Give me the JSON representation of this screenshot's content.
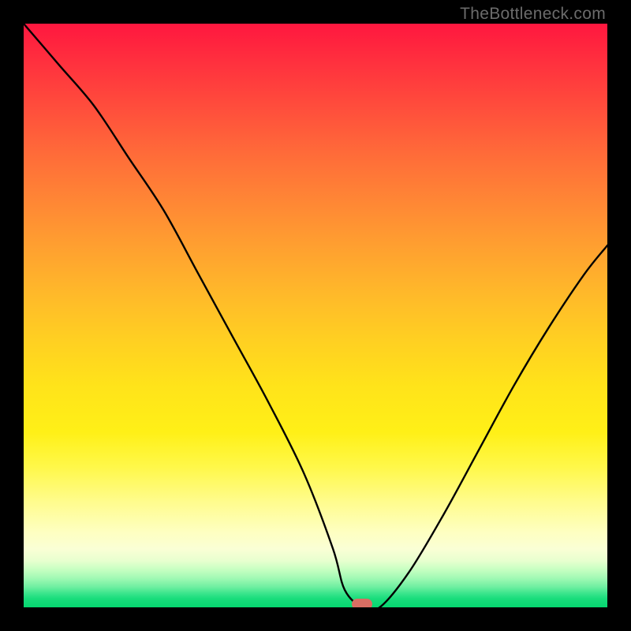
{
  "watermark": "TheBottleneck.com",
  "marker": {
    "x_pct": 58,
    "y_pct": 99.4,
    "color": "#d96e63"
  },
  "chart_data": {
    "type": "line",
    "title": "",
    "xlabel": "",
    "ylabel": "",
    "xlim": [
      0,
      100
    ],
    "ylim": [
      0,
      100
    ],
    "grid": false,
    "legend": false,
    "background_gradient": {
      "direction": "vertical",
      "stops": [
        {
          "pos": 0,
          "color": "#ff173f"
        },
        {
          "pos": 0.3,
          "color": "#ff8535"
        },
        {
          "pos": 0.6,
          "color": "#ffe31a"
        },
        {
          "pos": 0.85,
          "color": "#fffcb0"
        },
        {
          "pos": 0.95,
          "color": "#8cf4ad"
        },
        {
          "pos": 1.0,
          "color": "#05d770"
        }
      ]
    },
    "series": [
      {
        "name": "bottleneck-curve",
        "color": "#000000",
        "x": [
          0,
          6,
          12,
          18,
          24,
          30,
          36,
          42,
          48,
          53,
          55,
          58,
          61,
          66,
          72,
          78,
          84,
          90,
          96,
          100
        ],
        "values": [
          100,
          93,
          86,
          77,
          68,
          57,
          46,
          35,
          23,
          10,
          3,
          0,
          0,
          6,
          16,
          27,
          38,
          48,
          57,
          62
        ]
      }
    ],
    "annotations": [
      {
        "type": "pill-marker",
        "x": 58,
        "y": 0,
        "color": "#d96e63"
      }
    ]
  }
}
